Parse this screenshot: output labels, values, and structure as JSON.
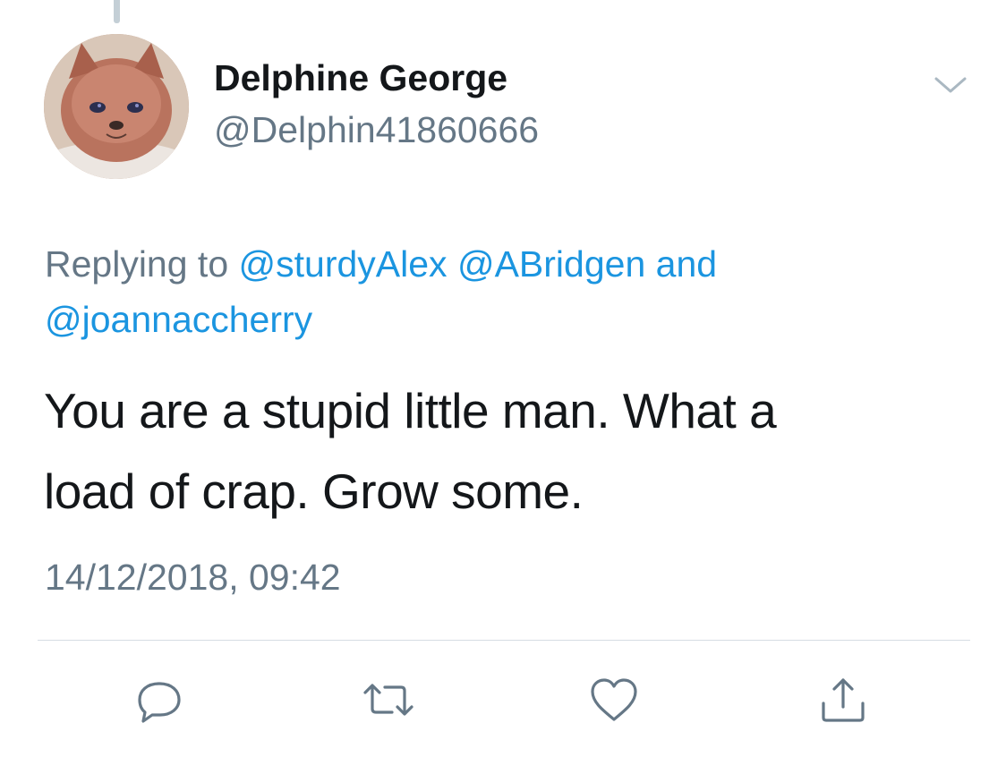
{
  "tweet": {
    "author": {
      "display_name": "Delphine George",
      "handle": "@Delphin41860666",
      "avatar_icon": "kitten-avatar"
    },
    "replying_to": {
      "prefix": "Replying to",
      "mentions": [
        "@sturdyAlex",
        "@ABridgen"
      ],
      "conjunction": "and",
      "last_mention": "@joannaccherry"
    },
    "text_line_1": "You are a stupid little man. What a",
    "text_line_2": "load of crap. Grow some.",
    "timestamp": "14/12/2018, 09:42",
    "menu_icon": "chevron-down-icon"
  },
  "actions": [
    {
      "name": "reply",
      "icon": "comment-icon"
    },
    {
      "name": "retweet",
      "icon": "retweet-icon"
    },
    {
      "name": "like",
      "icon": "heart-icon"
    },
    {
      "name": "share",
      "icon": "share-icon"
    }
  ],
  "colors": {
    "text_primary": "#14171a",
    "text_secondary": "#657786",
    "link": "#1b95e0",
    "icon": "#657786",
    "divider": "#d6dde3"
  }
}
